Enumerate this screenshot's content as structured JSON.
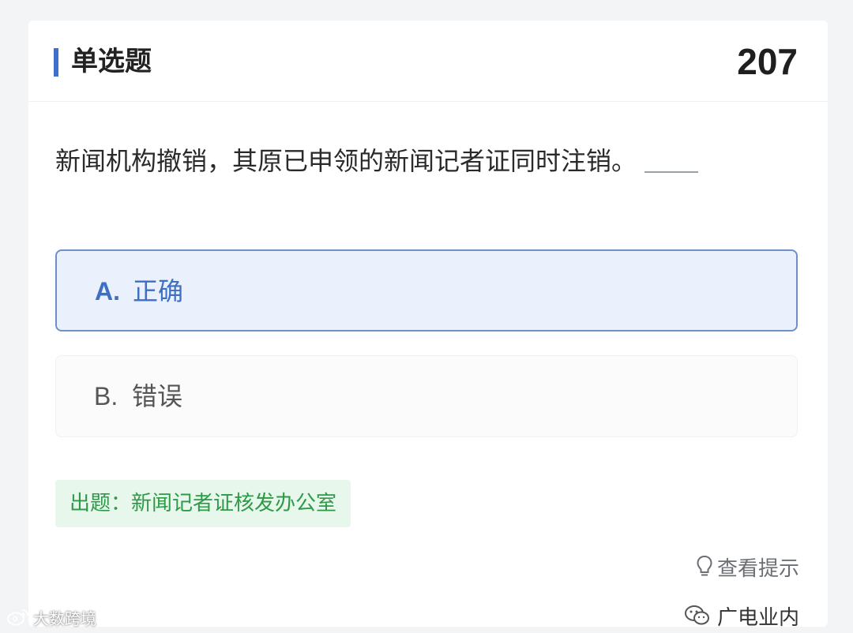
{
  "header": {
    "question_type": "单选题",
    "question_number": "207"
  },
  "question": {
    "text": "新闻机构撤销，其原已申领的新闻记者证同时注销。"
  },
  "options": [
    {
      "letter": "A.",
      "text": "正确",
      "selected": true
    },
    {
      "letter": "B.",
      "text": "错误",
      "selected": false
    }
  ],
  "source": {
    "label": "出题：新闻记者证核发办公室"
  },
  "hint": {
    "icon": "lightbulb-icon",
    "label": "查看提示"
  },
  "watermarks": {
    "right": {
      "icon": "wechat-icon",
      "text": "广电业内"
    },
    "left": {
      "icon": "weibo-icon",
      "text": "大数跨境"
    }
  },
  "colors": {
    "accent": "#3e6fd0",
    "selected_option_bg": "#eaf1fd",
    "source_green": "#2e9a48"
  }
}
